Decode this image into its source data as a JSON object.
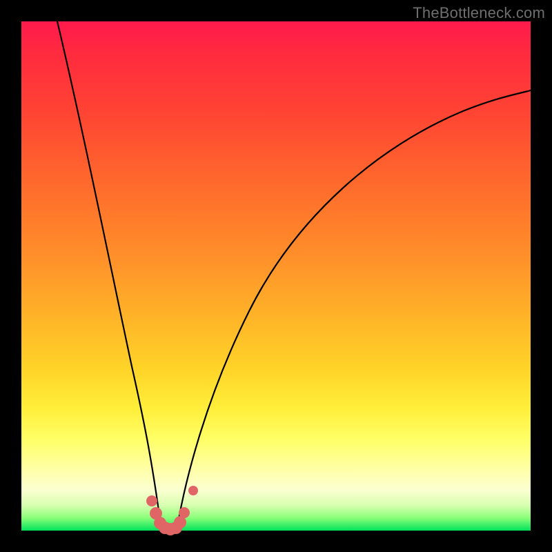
{
  "watermark": "TheBottleneck.com",
  "colors": {
    "frame": "#000000",
    "curve": "#000000",
    "marker": "#e06666"
  },
  "chart_data": {
    "type": "line",
    "title": "",
    "xlabel": "",
    "ylabel": "",
    "xlim": [
      0,
      100
    ],
    "ylim": [
      0,
      100
    ],
    "background_gradient": [
      "#ff1a4d",
      "#ffee3a",
      "#00e25a"
    ],
    "series": [
      {
        "name": "left-branch",
        "x": [
          7,
          10,
          13,
          16,
          18,
          20,
          22,
          23.5,
          25,
          26.5,
          27.5
        ],
        "y": [
          100,
          82,
          64,
          48,
          37,
          27,
          18,
          12,
          7,
          3,
          0
        ]
      },
      {
        "name": "right-branch",
        "x": [
          30.5,
          33,
          36,
          40,
          45,
          51,
          58,
          66,
          75,
          85,
          95,
          100
        ],
        "y": [
          0,
          8,
          18,
          30,
          42,
          52,
          61,
          69,
          75,
          80,
          84,
          86
        ]
      }
    ],
    "markers": {
      "name": "optimal-zone",
      "points": [
        {
          "x": 25.5,
          "y": 6
        },
        {
          "x": 26.5,
          "y": 3
        },
        {
          "x": 27.2,
          "y": 1.2
        },
        {
          "x": 28.0,
          "y": 0.4
        },
        {
          "x": 29.0,
          "y": 0.2
        },
        {
          "x": 30.0,
          "y": 0.4
        },
        {
          "x": 30.8,
          "y": 1.2
        },
        {
          "x": 31.6,
          "y": 3
        },
        {
          "x": 33.5,
          "y": 8
        }
      ]
    }
  }
}
